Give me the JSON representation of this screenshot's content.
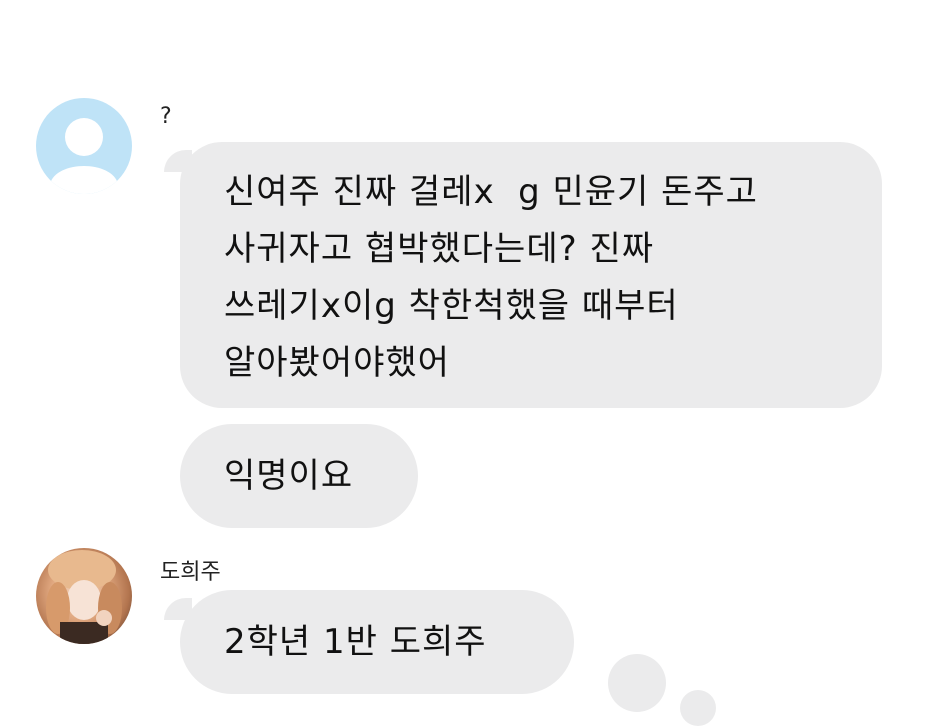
{
  "conversation": {
    "messages": [
      {
        "sender": "?",
        "avatar": "default-user-avatar",
        "bubbles": [
          "신여주 진짜 걸레x   g 민윤기 돈주고\n사귀자고 협박했다는데? 진짜\n쓰레기x이g 착한척했을 때부터\n알아봤어야했어",
          "익명이요"
        ]
      },
      {
        "sender": "도희주",
        "avatar": "profile-photo",
        "bubbles": [
          "2학년 1반 도희주"
        ]
      }
    ]
  },
  "colors": {
    "bubble": "#ebebec",
    "default_avatar_bg": "#bfe3f7",
    "default_avatar_fg": "#ffffff",
    "text": "#111111"
  }
}
